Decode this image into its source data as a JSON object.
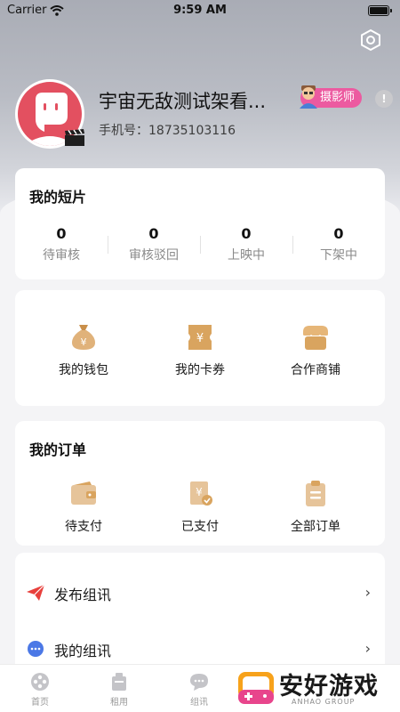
{
  "status_bar": {
    "carrier": "Carrier",
    "time": "9:59 AM"
  },
  "profile": {
    "name": "宇宙无敌测试架看...",
    "role": "摄影师",
    "phone": "手机号：18735103116"
  },
  "shorts": {
    "title": "我的短片",
    "stats": [
      {
        "value": "0",
        "label": "待审核"
      },
      {
        "value": "0",
        "label": "审核驳回"
      },
      {
        "value": "0",
        "label": "上映中"
      },
      {
        "value": "0",
        "label": "下架中"
      }
    ]
  },
  "services": [
    {
      "label": "我的钱包",
      "icon": "money-bag-icon"
    },
    {
      "label": "我的卡券",
      "icon": "coupon-icon"
    },
    {
      "label": "合作商铺",
      "icon": "shop-icon"
    }
  ],
  "orders": {
    "title": "我的订单",
    "items": [
      {
        "label": "待支付",
        "icon": "wallet-icon"
      },
      {
        "label": "已支付",
        "icon": "paid-icon"
      },
      {
        "label": "全部订单",
        "icon": "clipboard-icon"
      }
    ]
  },
  "menu": [
    {
      "label": "发布组讯",
      "icon": "paper-plane-icon"
    },
    {
      "label": "我的组讯",
      "icon": "chat-bubble-icon"
    }
  ],
  "tabbar": [
    {
      "label": "首页",
      "icon": "film-reel-icon"
    },
    {
      "label": "租用",
      "icon": "rental-icon"
    },
    {
      "label": "组讯",
      "icon": "message-icon"
    }
  ],
  "watermark": {
    "brand": "安好游戏",
    "sub": "ANHAO GROUP"
  },
  "colors": {
    "accent": "#d9a45f",
    "role_badge": "#ec5aa0",
    "avatar": "#e35060"
  }
}
